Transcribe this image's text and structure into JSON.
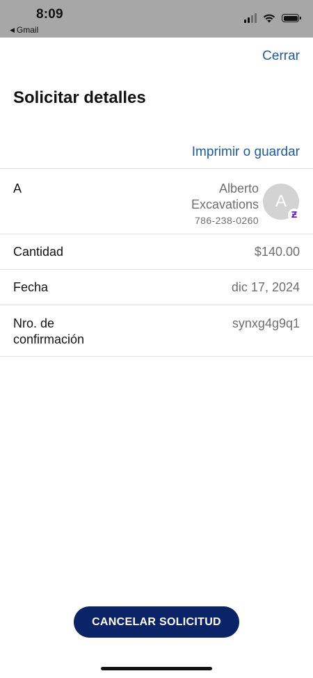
{
  "status_bar": {
    "time": "8:09",
    "back_app": "Gmail",
    "back_arrow_icon": "triangle-left-icon",
    "icons": [
      "cellular-signal-icon",
      "wifi-icon",
      "battery-icon"
    ]
  },
  "header": {
    "close_label": "Cerrar",
    "title": "Solicitar detalles",
    "print_label": "Imprimir o guardar"
  },
  "details": {
    "to": {
      "label": "A",
      "name": "Alberto Excavations",
      "phone": "786-238-0260",
      "avatar_initial": "A",
      "badge_icon": "zelle-icon",
      "badge_symbol": "Ƶ"
    },
    "amount": {
      "label": "Cantidad",
      "value": "$140.00"
    },
    "date": {
      "label": "Fecha",
      "value": "dic 17, 2024"
    },
    "confirmation": {
      "label": "Nro. de confirmación",
      "value": "synxg4g9q1"
    }
  },
  "actions": {
    "cancel_label": "CANCELAR SOLICITUD"
  },
  "colors": {
    "link": "#1b5ba6",
    "primary_button": "#0b2468",
    "status_bar_bg": "#a7a7a7",
    "zelle_purple": "#6d1ed4"
  }
}
